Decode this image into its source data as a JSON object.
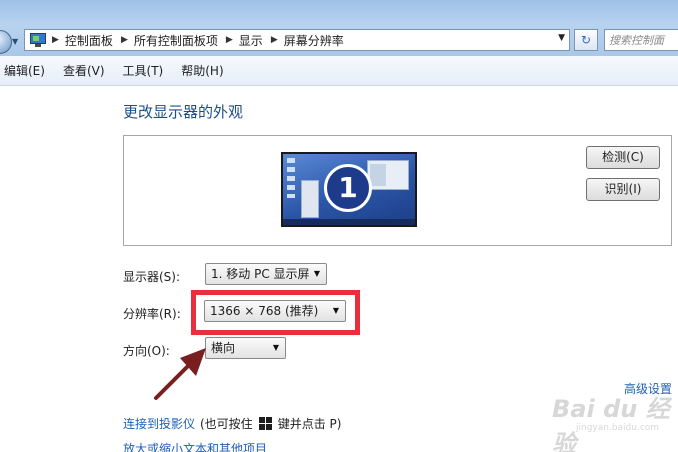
{
  "titlebar": {
    "ghost_text": ""
  },
  "address_bar": {
    "crumbs": [
      "控制面板",
      "所有控制面板项",
      "显示",
      "屏幕分辨率"
    ]
  },
  "search": {
    "placeholder": "搜索控制面"
  },
  "menu": {
    "items": [
      {
        "label": "编辑(E)"
      },
      {
        "label": "查看(V)"
      },
      {
        "label": "工具(T)"
      },
      {
        "label": "帮助(H)"
      }
    ]
  },
  "main": {
    "title": "更改显示器的外观",
    "monitor_number": "1",
    "detect_label": "检测(C)",
    "identify_label": "识别(I)",
    "display": {
      "label": "显示器(S):",
      "value": "1. 移动 PC 显示屏"
    },
    "resolution": {
      "label": "分辨率(R):",
      "value": "1366 × 768 (推荐)"
    },
    "orientation": {
      "label": "方向(O):",
      "value": "横向"
    },
    "advanced_link": "高级设置",
    "projector_link": "连接到投影仪",
    "projector_note_prefix": "(也可按住",
    "projector_note_suffix": "键并点击 P)",
    "zoom_link": "放大或缩小文本和其他项目"
  },
  "watermark": {
    "brand": "Bai du 经验",
    "sub": "jingyan.baidu.com"
  },
  "colors": {
    "highlight": "#e8303a",
    "arrow": "#7a1f1f",
    "link": "#1f5fb5",
    "title": "#1e4e8a"
  }
}
